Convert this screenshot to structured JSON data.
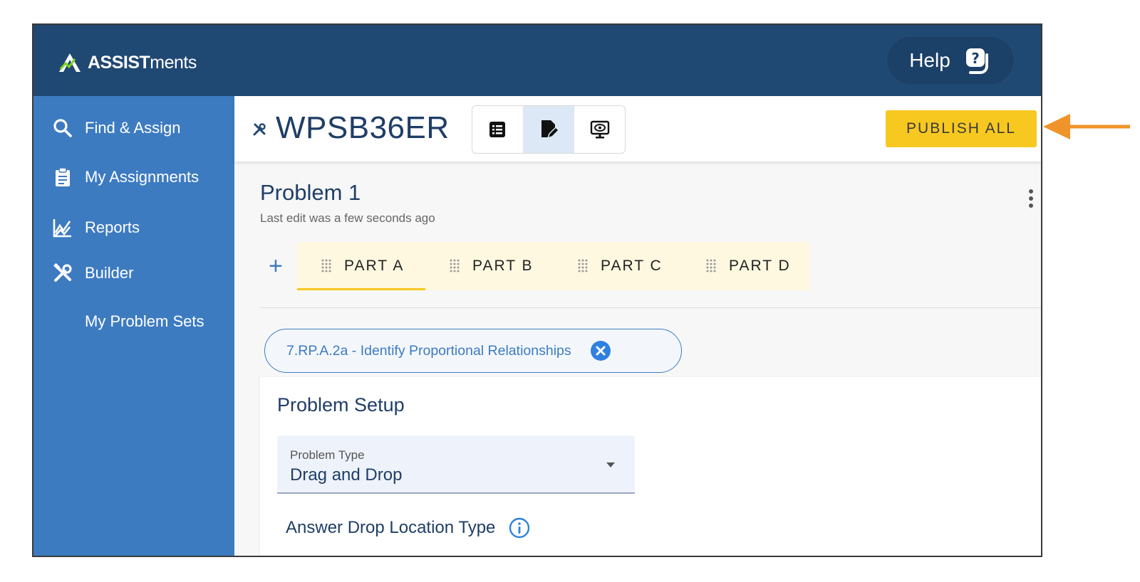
{
  "app": {
    "logo_bold": "ASSIST",
    "logo_rest": "ments"
  },
  "help": {
    "label": "Help",
    "icon": "help-question-icon"
  },
  "sidebar": {
    "items": [
      {
        "label": "Find & Assign",
        "icon": "search-icon"
      },
      {
        "label": "My Assignments",
        "icon": "clipboard-icon"
      },
      {
        "label": "Reports",
        "icon": "chart-icon"
      },
      {
        "label": "Builder",
        "icon": "tools-icon"
      }
    ],
    "sub_item": "My Problem Sets"
  },
  "header": {
    "set_code": "WPSB36ER",
    "modes": [
      {
        "name": "list-view",
        "icon": "list-icon",
        "active": false
      },
      {
        "name": "edit-view",
        "icon": "edit-document-icon",
        "active": true
      },
      {
        "name": "preview-view",
        "icon": "preview-monitor-icon",
        "active": false
      }
    ],
    "publish_label": "PUBLISH ALL",
    "publish_color": "#f7c820"
  },
  "problem": {
    "title": "Problem 1",
    "last_edit": "Last edit was a few seconds ago",
    "add_part_label": "+",
    "parts": [
      {
        "label": "PART A",
        "active": true
      },
      {
        "label": "PART B",
        "active": false
      },
      {
        "label": "PART C",
        "active": false
      },
      {
        "label": "PART D",
        "active": false
      }
    ],
    "standard": "7.RP.A.2a - Identify Proportional Relationships"
  },
  "setup": {
    "title": "Problem Setup",
    "type_label": "Problem Type",
    "type_value": "Drag and Drop",
    "drop_location_label": "Answer Drop Location Type"
  },
  "colors": {
    "topbar": "#1f4873",
    "sidebar": "#3d7bc1",
    "accent_yellow": "#f7c820",
    "annotation_arrow": "#f0932b"
  }
}
